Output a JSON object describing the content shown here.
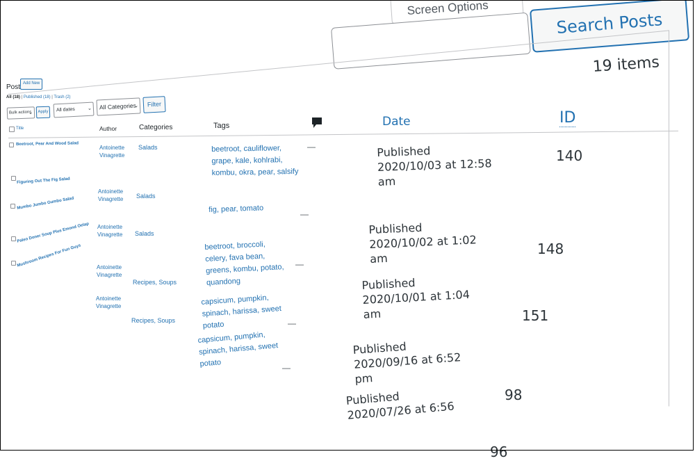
{
  "header": {
    "screen_options_label": "Screen Options",
    "search_placeholder": "",
    "search_button_label": "Search Posts",
    "items_count": "19 items"
  },
  "page": {
    "title": "Posts",
    "add_new_label": "Add New"
  },
  "views": {
    "all": "All (18)",
    "published": "Published (18)",
    "trash": "Trash (2)"
  },
  "filters": {
    "bulk_actions": "Bulk actions",
    "apply": "Apply",
    "all_dates": "All dates",
    "all_categories": "All Categories",
    "filter": "Filter"
  },
  "table": {
    "columns": {
      "title": "Title",
      "author": "Author",
      "categories": "Categories",
      "tags": "Tags",
      "comments_icon": "comment-bubble",
      "date": "Date",
      "id": "ID"
    },
    "rows": [
      {
        "title": "Beetroot, Pear And Wood Salad",
        "author": "Antoinette Vinagrette",
        "categories": "Salads",
        "tags": "beetroot, cauliflower, grape, kale, kohlrabi, kombu, okra, pear, salsify",
        "comments": "—",
        "status": "Published",
        "date": "2020/10/03 at 12:58 am",
        "id": "140"
      },
      {
        "title": "Figuring Out The Fig Salad",
        "author": "Antoinette Vinagrette",
        "categories": "Salads",
        "tags": "fig, pear, tomato",
        "comments": "—",
        "status": "Published",
        "date": "2020/10/02 at 1:02 am",
        "id": "148"
      },
      {
        "title": "Mumbo Jumbo Gumbo Salad",
        "author": "Antoinette Vinagrette",
        "categories": "Salads",
        "tags": "beetroot, broccoli, celery, fava bean, greens, kombu, potato, quandong",
        "comments": "—",
        "status": "Published",
        "date": "2020/10/01 at 1:04 am",
        "id": "151"
      },
      {
        "title": "Paleo Doner Soup Plus Emond Oelap",
        "author": "Antoinette Vinagrette",
        "categories": "Recipes, Soups",
        "tags": "capsicum, pumpkin, spinach, harissa, sweet potato",
        "comments": "—",
        "status": "Published",
        "date": "2020/09/16 at 6:52 pm",
        "id": "98"
      },
      {
        "title": "Mushroom Recipes For Fun Guys",
        "author": "Antoinette Vinagrette",
        "categories": "Recipes, Soups",
        "tags": "capsicum, pumpkin, spinach, harissa, sweet potato",
        "comments": "—",
        "status": "Published",
        "date": "2020/07/26 at 6:56",
        "id": "96"
      }
    ]
  }
}
